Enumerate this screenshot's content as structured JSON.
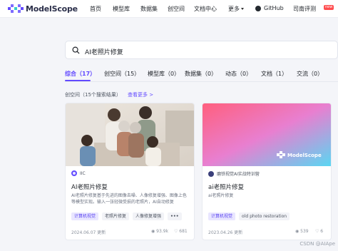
{
  "brand": {
    "name": "ModelScope"
  },
  "nav": {
    "items": [
      "首页",
      "模型库",
      "数据集",
      "创空间",
      "文档中心"
    ],
    "more": "更多",
    "github": "GitHub",
    "eval": "司南评测",
    "new_badge": "new"
  },
  "search": {
    "query": "AI老照片修复"
  },
  "tabs": [
    {
      "label": "综合（17）",
      "active": true
    },
    {
      "label": "创空间（15）"
    },
    {
      "label": "模型库（0）"
    },
    {
      "label": "数据集（0）"
    },
    {
      "label": "动态（0）"
    },
    {
      "label": "文档（1）"
    },
    {
      "label": "交流（0）"
    }
  ],
  "section": {
    "title": "创空间（15个搜索结果）",
    "more": "查看更多 >"
  },
  "cards": [
    {
      "owner": "IIC",
      "title": "AI老照片修复",
      "desc": "AI老照片修复基于先进的图像去噪、人像修复增强、图像上色等模型实现。输入一张轻微受损的老照片，AI自动修复",
      "tags": [
        "计算机视觉",
        "老照片修复",
        "人像修复增强"
      ],
      "date": "2024.06.07 更新",
      "views": "93.9k",
      "likes": "681"
    },
    {
      "owner": "磨铁视觉AI实战特训营",
      "title": "ai老照片修复",
      "desc": "ai老照片修复",
      "tags": [
        "计算机视觉",
        "old photo restoration"
      ],
      "date": "2023.04.26 更新",
      "views": "539",
      "likes": "6"
    }
  ],
  "card2_logo": "ModelScope",
  "watermark": "CSDN @AIApe"
}
